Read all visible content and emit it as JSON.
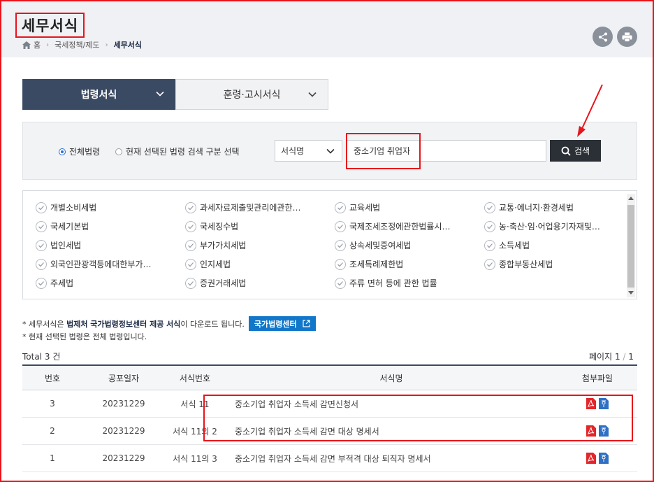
{
  "header": {
    "title": "세무서식",
    "breadcrumb": [
      "홈",
      "국세정책/제도",
      "세무서식"
    ]
  },
  "actions": {
    "share_icon": "share-icon",
    "print_icon": "print-icon"
  },
  "tabs": [
    {
      "label": "법령서식",
      "active": true
    },
    {
      "label": "훈령·고시서식",
      "active": false
    }
  ],
  "search": {
    "radio_all": "전체법령",
    "radio_current": "현재 선택된 법령 검색 구분 선택",
    "select_value": "서식명",
    "query": "중소기업 취업자",
    "button_label": "검색"
  },
  "laws": [
    "개별소비세법",
    "과세자료제출및관리에관한…",
    "교육세법",
    "교통·에너지·환경세법",
    "국세기본법",
    "국세징수법",
    "국제조세조정에관한법률시…",
    "농·축산·임·어업용기자재및…",
    "법인세법",
    "부가가치세법",
    "상속세및증여세법",
    "소득세법",
    "외국인관광객등에대한부가…",
    "인지세법",
    "조세특례제한법",
    "종합부동산세법",
    "주세법",
    "증권거래세법",
    "주류 면허 등에 관한 법률"
  ],
  "notice": {
    "line1_prefix": "* 세무서식은",
    "line1_strong": "법제처 국가법령정보센터 제공 서식",
    "line1_suffix": "이 다운로드 됩니다.",
    "button": "국가법령센터",
    "line2": "* 현재 선택된 법령은 전체 법령입니다."
  },
  "summary": {
    "total_label": "Total",
    "total_count": "3",
    "total_unit": "건",
    "page_label": "페이지",
    "page_current": "1",
    "page_total": "1"
  },
  "table": {
    "headers": [
      "번호",
      "공포일자",
      "서식번호",
      "서식명",
      "첨부파일"
    ],
    "rows": [
      {
        "no": "3",
        "date": "20231229",
        "form_no": "서식 11",
        "name": "중소기업 취업자 소득세 감면신청서"
      },
      {
        "no": "2",
        "date": "20231229",
        "form_no": "서식 11의 2",
        "name": "중소기업 취업자 소득세 감면 대상 명세서"
      },
      {
        "no": "1",
        "date": "20231229",
        "form_no": "서식 11의 3",
        "name": "중소기업 취업자 소득세 감면 부적격 대상 퇴직자 명세서"
      }
    ]
  },
  "colors": {
    "accent": "#3b4a63",
    "highlight": "#e8141b",
    "link_button": "#1276c9",
    "pdf": "#e3262b",
    "hwp": "#2f6fc4"
  }
}
